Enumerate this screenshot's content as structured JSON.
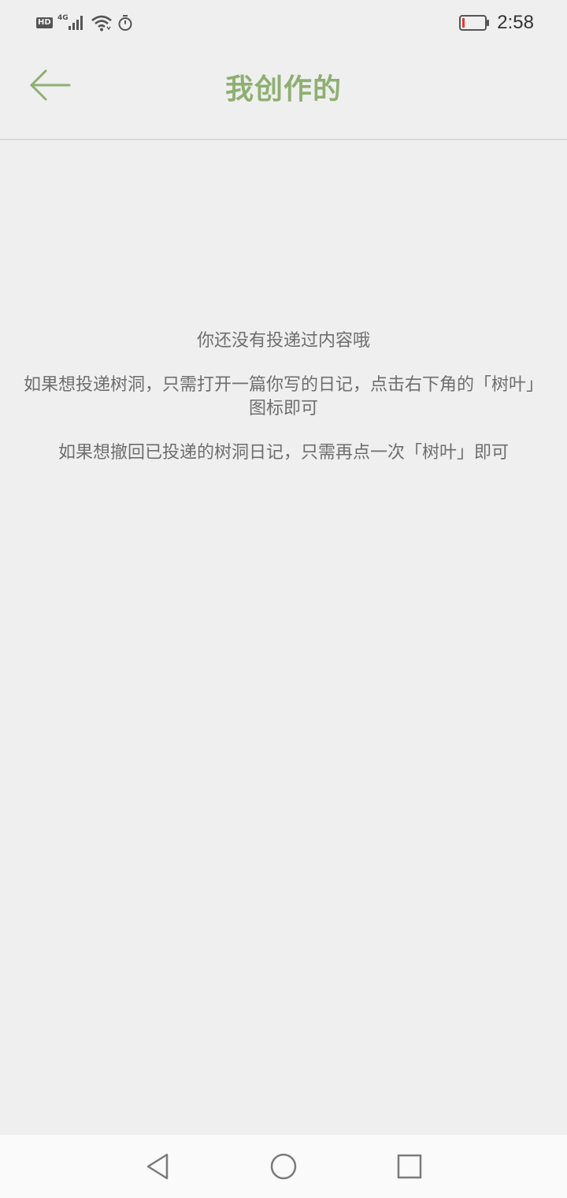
{
  "status_bar": {
    "network_badge": "HD",
    "network_type": "4G",
    "time": "2:58",
    "icons": [
      "hd-icon",
      "signal-icon",
      "wifi-icon",
      "timer-icon",
      "battery-icon"
    ],
    "battery_level": 0.1,
    "battery_color": "#e03c3c"
  },
  "header": {
    "title": "我创作的",
    "accent_color": "#8faf72",
    "back_icon": "arrow-left-icon"
  },
  "empty_state": {
    "line1": "你还没有投递过内容哦",
    "line2": "如果想投递树洞，只需打开一篇你写的日记，点击右下角的「树叶」图标即可",
    "line3": "如果想撤回已投递的树洞日记，只需再点一次「树叶」即可"
  },
  "nav_bar": {
    "icons": [
      "back-triangle-icon",
      "home-circle-icon",
      "recents-square-icon"
    ]
  }
}
